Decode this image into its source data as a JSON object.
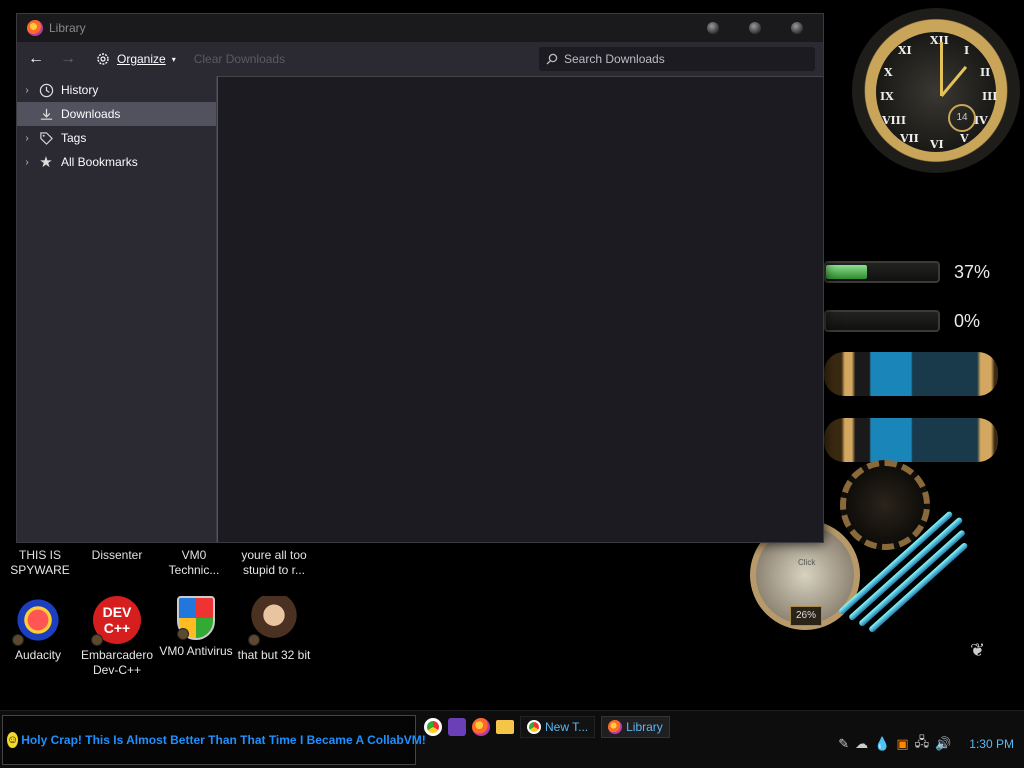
{
  "window": {
    "title": "Library",
    "toolbar": {
      "back_label": "←",
      "forward_label": "→",
      "organize_label": "Organize",
      "clear_downloads_label": "Clear Downloads",
      "search_placeholder": "Search Downloads"
    },
    "sidebar": {
      "items": [
        {
          "label": "History",
          "icon": "clock-icon",
          "expandable": true,
          "selected": false
        },
        {
          "label": "Downloads",
          "icon": "download-icon",
          "expandable": false,
          "selected": true
        },
        {
          "label": "Tags",
          "icon": "tag-icon",
          "expandable": true,
          "selected": false
        },
        {
          "label": "All Bookmarks",
          "icon": "star-icon",
          "expandable": true,
          "selected": false
        }
      ]
    }
  },
  "desktop": {
    "partial_labels": [
      {
        "line1": "THIS IS",
        "line2": "SPYWARE"
      },
      {
        "line1": "Dissenter",
        "line2": ""
      },
      {
        "line1": "VM0",
        "line2": "Technic..."
      },
      {
        "line1": "youre all too",
        "line2": "stupid to r..."
      }
    ],
    "icons": [
      {
        "line1": "Audacity",
        "line2": ""
      },
      {
        "line1": "Embarcadero",
        "line2": "Dev-C++"
      },
      {
        "line1": "VM0 Antivirus",
        "line2": ""
      },
      {
        "line1": "that but 32 bit",
        "line2": ""
      }
    ],
    "devcpp_logo_text": "DEV\nC++"
  },
  "widgets": {
    "clock": {
      "numerals": [
        "XII",
        "I",
        "II",
        "III",
        "IV",
        "V",
        "VI",
        "VII",
        "VIII",
        "IX",
        "X",
        "XI"
      ],
      "date": "14"
    },
    "gauges": [
      {
        "percent_label": "37%",
        "fill_percent": 37
      },
      {
        "percent_label": "0%",
        "fill_percent": 0
      }
    ],
    "small_gauge_label": "26%",
    "meter_label": "Click"
  },
  "taskbar": {
    "message": "Holy Crap! This Is Almost Better Than That Time I Became A CollabVM!",
    "tasks": [
      {
        "label": "New T...",
        "icon": "chrome-icon"
      },
      {
        "label": "Library",
        "icon": "firefox-icon"
      }
    ],
    "time": "1:30 PM"
  }
}
